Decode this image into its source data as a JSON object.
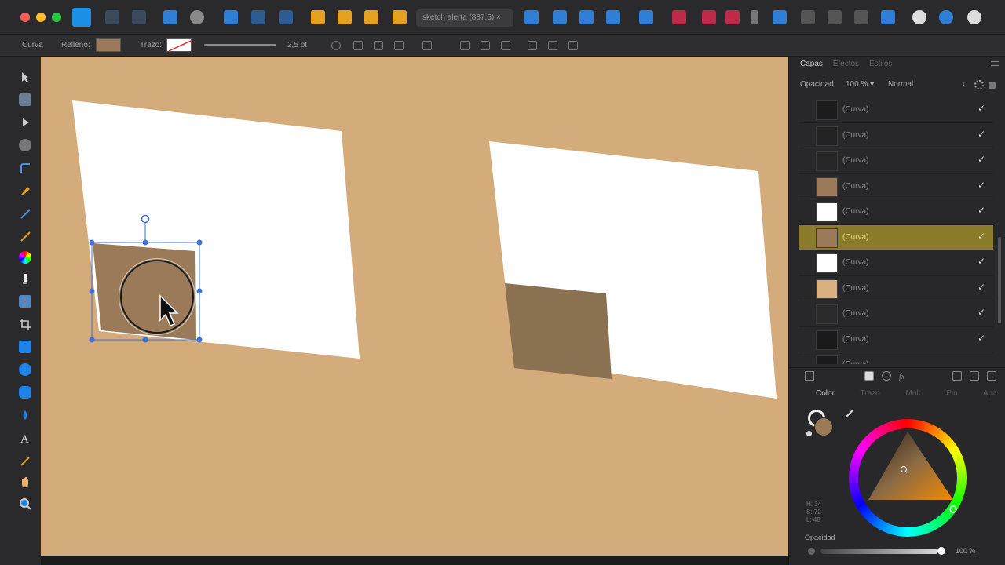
{
  "toolbar": {
    "document_tab": "sketch alerta (887,5) ×"
  },
  "context": {
    "curve_label": "Curva",
    "fill_label": "Relleno:",
    "fill_color": "#9a7a58",
    "stroke_label": "Trazo:",
    "stroke_width": "2,5 pt"
  },
  "layers_panel": {
    "tabs": [
      "Capas",
      "Efectos",
      "Estilos"
    ],
    "opacity_label": "Opacidad:",
    "opacity_value": "100 % ▾",
    "blend_mode": "Normal",
    "layers": [
      {
        "name": "(Curva)",
        "thumb": "#1c1c1c",
        "checked": "✓",
        "selected": false
      },
      {
        "name": "(Curva)",
        "thumb": "#222222",
        "checked": "✓",
        "selected": false
      },
      {
        "name": "(Curva)",
        "thumb": "#262626",
        "checked": "✓",
        "selected": false
      },
      {
        "name": "(Curva)",
        "thumb": "#9a7a58",
        "checked": "✓",
        "selected": false
      },
      {
        "name": "(Curva)",
        "thumb": "#ffffff",
        "checked": "✓",
        "selected": false
      },
      {
        "name": "(Curva)",
        "thumb": "#9a7a58",
        "checked": "✓",
        "selected": true
      },
      {
        "name": "(Curva)",
        "thumb": "#ffffff",
        "checked": "✓",
        "selected": false
      },
      {
        "name": "(Curva)",
        "thumb": "#d9b07e",
        "checked": "✓",
        "selected": false
      },
      {
        "name": "(Curva)",
        "thumb": "#2a2a2a",
        "checked": "✓",
        "selected": false
      },
      {
        "name": "(Curva)",
        "thumb": "#1a1a1a",
        "checked": "✓",
        "selected": false
      },
      {
        "name": "(Curva)",
        "thumb": "#1a1a1a",
        "checked": "",
        "selected": false
      }
    ]
  },
  "color_panel": {
    "tabs": [
      "Color",
      "Trazo",
      "Mult",
      "Pin",
      "Apa"
    ],
    "hsl": [
      "H: 34",
      "S: 72",
      "L: 48"
    ],
    "opacity_label": "Opacidad",
    "opacity_value": "100 %"
  },
  "colors": {
    "canvas_bg": "#d4ab7a",
    "brown": "#9a7a58",
    "brown_right": "#8a7152",
    "selection": "#3e6fd8"
  }
}
